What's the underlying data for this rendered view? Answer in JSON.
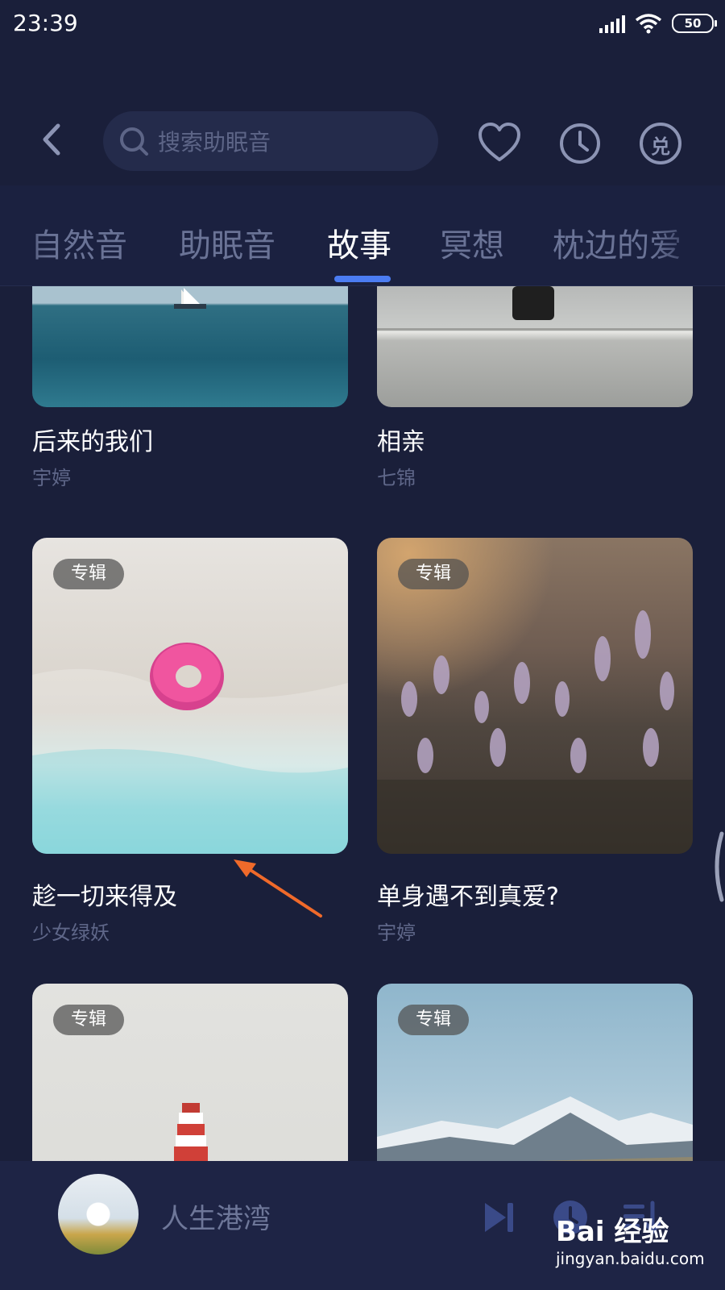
{
  "status_bar": {
    "time": "23:39",
    "battery": "50"
  },
  "header": {
    "search_placeholder": "搜索助眠音",
    "icons": [
      "back-icon",
      "search-icon",
      "heart-icon",
      "clock-icon",
      "redeem-icon"
    ],
    "redeem_glyph": "兑"
  },
  "tabs": [
    {
      "label": "自然音",
      "active": false
    },
    {
      "label": "助眠音",
      "active": false
    },
    {
      "label": "故事",
      "active": true
    },
    {
      "label": "冥想",
      "active": false
    },
    {
      "label": "枕边的爱",
      "active": false
    }
  ],
  "cards": [
    {
      "title": "后来的我们",
      "author": "宇婷",
      "badge": ""
    },
    {
      "title": "相亲",
      "author": "七锦",
      "badge": ""
    },
    {
      "title": "趁一切来得及",
      "author": "少女绿妖",
      "badge": "专辑"
    },
    {
      "title": "单身遇不到真爱?",
      "author": "宇婷",
      "badge": "专辑"
    },
    {
      "title": "",
      "author": "",
      "badge": "专辑"
    },
    {
      "title": "",
      "author": "",
      "badge": "专辑"
    }
  ],
  "player": {
    "title": "人生港湾",
    "icons": [
      "skip-next-icon",
      "timer-icon",
      "playlist-icon"
    ]
  },
  "watermark": {
    "logo": "Bai 经验",
    "url": "jingyan.baidu.com"
  },
  "colors": {
    "background": "#1a1f3a",
    "accent": "#4b7cf2",
    "annotation_arrow": "#f06a2a"
  }
}
